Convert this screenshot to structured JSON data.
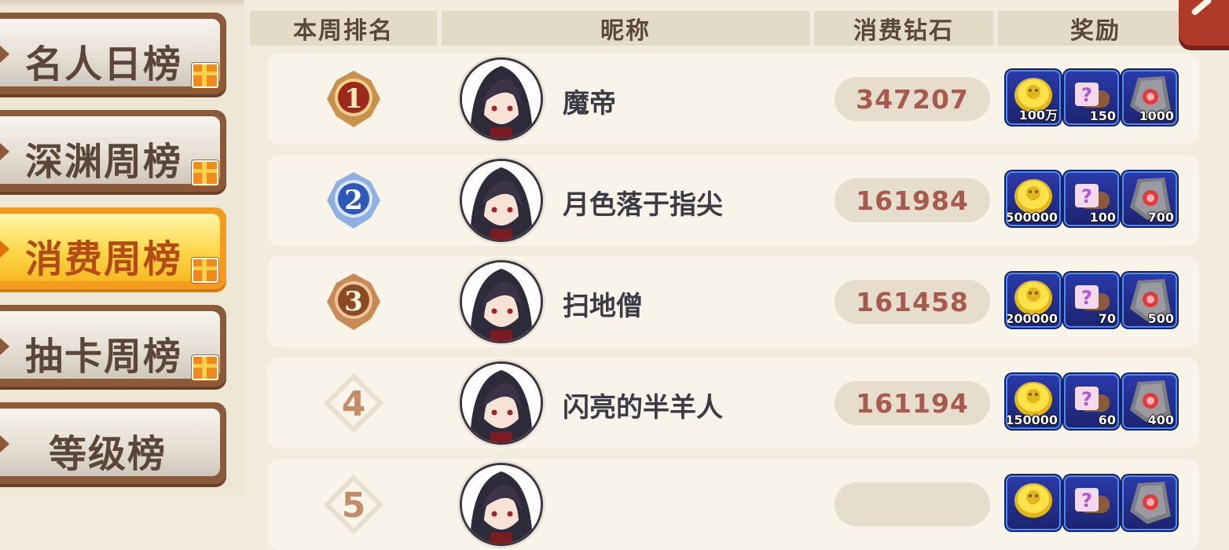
{
  "sidebar": {
    "tabs": [
      {
        "label": "名人日榜",
        "active": false
      },
      {
        "label": "深渊周榜",
        "active": false
      },
      {
        "label": "消费周榜",
        "active": true
      },
      {
        "label": "抽卡周榜",
        "active": false
      },
      {
        "label": "等级榜",
        "active": false
      }
    ]
  },
  "header": {
    "rank": "本周排名",
    "nickname": "昵称",
    "diamonds": "消费钻石",
    "rewards": "奖励"
  },
  "rows": [
    {
      "rank": "1",
      "medal": "gold-medal-icon",
      "nickname": "魔帝",
      "diamonds": "347207",
      "rewards": [
        {
          "icon": "gold-coin-icon",
          "qty": "100万"
        },
        {
          "icon": "mystery-scroll-icon",
          "qty": "150"
        },
        {
          "icon": "red-rune-stone-icon",
          "qty": "1000"
        }
      ]
    },
    {
      "rank": "2",
      "medal": "silver-medal-icon",
      "nickname": "月色落于指尖",
      "diamonds": "161984",
      "rewards": [
        {
          "icon": "gold-coin-icon",
          "qty": "500000"
        },
        {
          "icon": "mystery-scroll-icon",
          "qty": "100"
        },
        {
          "icon": "red-rune-stone-icon",
          "qty": "700"
        }
      ]
    },
    {
      "rank": "3",
      "medal": "bronze-medal-icon",
      "nickname": "扫地僧",
      "diamonds": "161458",
      "rewards": [
        {
          "icon": "gold-coin-icon",
          "qty": "200000"
        },
        {
          "icon": "mystery-scroll-icon",
          "qty": "70"
        },
        {
          "icon": "red-rune-stone-icon",
          "qty": "500"
        }
      ]
    },
    {
      "rank": "4",
      "medal": "diamond-frame-icon",
      "nickname": "闪亮的半羊人",
      "diamonds": "161194",
      "rewards": [
        {
          "icon": "gold-coin-icon",
          "qty": "150000"
        },
        {
          "icon": "mystery-scroll-icon",
          "qty": "60"
        },
        {
          "icon": "red-rune-stone-icon",
          "qty": "400"
        }
      ]
    },
    {
      "rank": "5",
      "medal": "diamond-frame-icon",
      "nickname": "",
      "diamonds": "",
      "rewards": [
        {
          "icon": "gold-coin-icon",
          "qty": ""
        },
        {
          "icon": "mystery-scroll-icon",
          "qty": ""
        },
        {
          "icon": "red-rune-stone-icon",
          "qty": ""
        }
      ]
    }
  ],
  "colors": {
    "background": "#f2ecdf",
    "active_tab": "#ffd74a",
    "active_tab_text": "#b44a14",
    "diamond_text": "#a85a4e",
    "reward_frame": "#4d88ff"
  }
}
